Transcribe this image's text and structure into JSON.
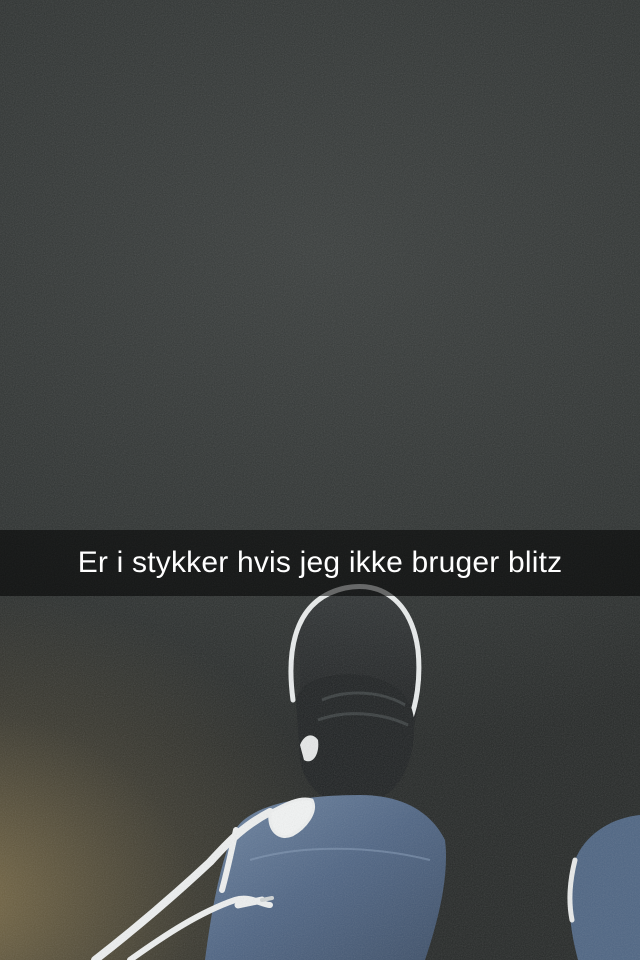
{
  "caption": {
    "text": "Er i stykker hvis jeg ikke bruger blitz"
  },
  "colors": {
    "caption_bar": "rgba(0,0,0,0.55)",
    "caption_text": "#ffffff",
    "background": "#2e3231",
    "warm_light": "#be a05f"
  }
}
